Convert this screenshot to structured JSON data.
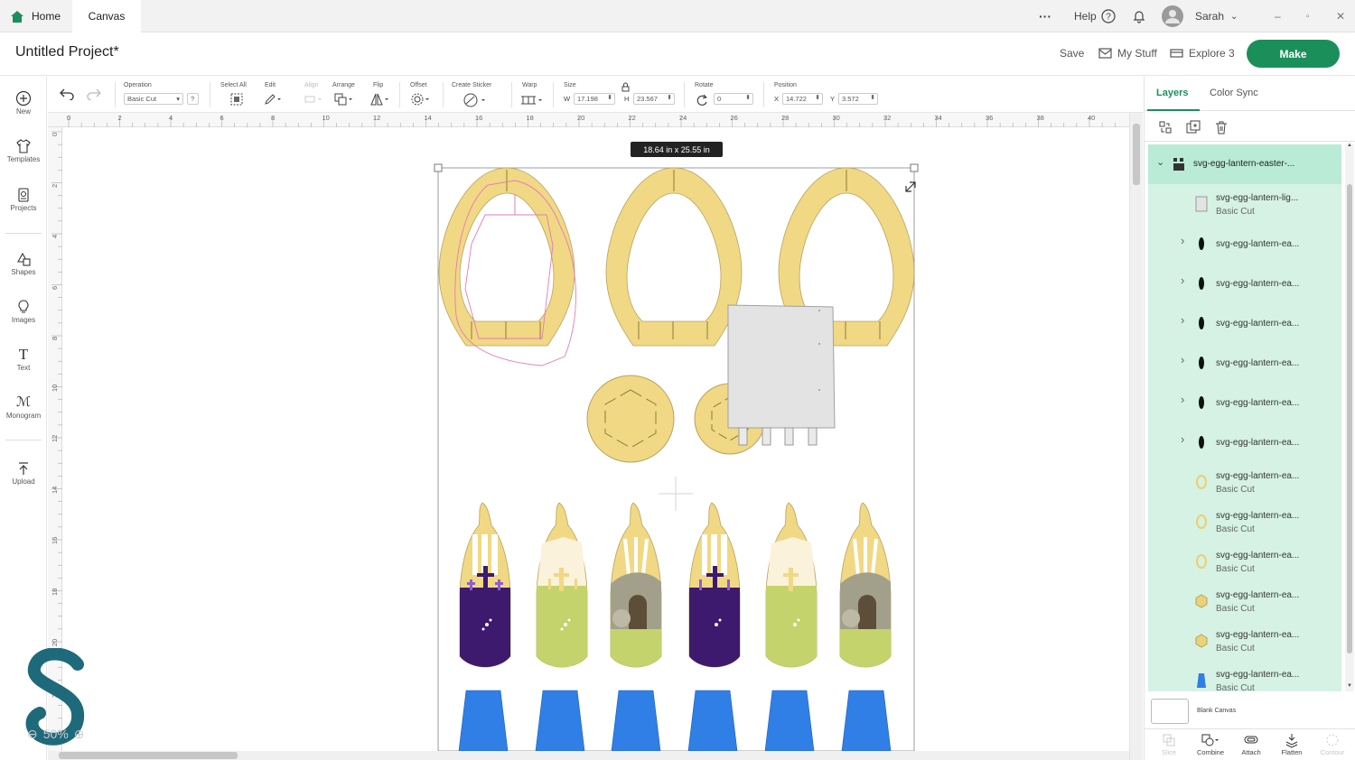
{
  "tabs": {
    "home": "Home",
    "canvas": "Canvas"
  },
  "topbar": {
    "more": "···",
    "help": "Help",
    "user": "Sarah",
    "minimize": "–",
    "restore": "▫",
    "close": "✕"
  },
  "header": {
    "title": "Untitled Project*",
    "save": "Save",
    "my_stuff": "My Stuff",
    "machine": "Explore 3",
    "make": "Make"
  },
  "leftbar": [
    "New",
    "Templates",
    "Projects",
    "Shapes",
    "Images",
    "Text",
    "Monogram",
    "Upload"
  ],
  "toolbar": {
    "operation_label": "Operation",
    "operation_value": "Basic Cut",
    "operation_help": "?",
    "select_all": "Select All",
    "edit": "Edit",
    "align": "Align",
    "arrange": "Arrange",
    "flip": "Flip",
    "offset": "Offset",
    "create_sticker": "Create Sticker",
    "warp": "Warp",
    "size": "Size",
    "w_label": "W",
    "w_value": "17.198",
    "h_label": "H",
    "h_value": "23.567",
    "rotate": "Rotate",
    "rotate_value": "0",
    "position": "Position",
    "x_label": "X",
    "x_value": "14.722",
    "y_label": "Y",
    "y_value": "3.572"
  },
  "ruler": {
    "top": [
      "0",
      "2",
      "4",
      "6",
      "8",
      "10",
      "12",
      "14",
      "16",
      "18",
      "20",
      "22",
      "24",
      "26",
      "28",
      "30",
      "32",
      "34",
      "36",
      "38",
      "40"
    ],
    "left": [
      "0",
      "2",
      "4",
      "6",
      "8",
      "10",
      "12",
      "14",
      "16",
      "18",
      "20",
      "22"
    ]
  },
  "canvas": {
    "dimension_tag": "18.64  in x 25.55  in",
    "zoom": "50%"
  },
  "panel": {
    "tab_layers": "Layers",
    "tab_color_sync": "Color Sync",
    "group_name": "svg-egg-lantern-easter-...",
    "layers": [
      {
        "name": "svg-egg-lantern-lig...",
        "sub": "Basic Cut",
        "expand": false,
        "thumb": "light",
        "color": "#e3e3e3"
      },
      {
        "name": "svg-egg-lantern-ea...",
        "sub": "",
        "expand": true,
        "thumb": "dark",
        "color": "#111111"
      },
      {
        "name": "svg-egg-lantern-ea...",
        "sub": "",
        "expand": true,
        "thumb": "dark",
        "color": "#111111"
      },
      {
        "name": "svg-egg-lantern-ea...",
        "sub": "",
        "expand": true,
        "thumb": "dark",
        "color": "#111111"
      },
      {
        "name": "svg-egg-lantern-ea...",
        "sub": "",
        "expand": true,
        "thumb": "dark",
        "color": "#111111"
      },
      {
        "name": "svg-egg-lantern-ea...",
        "sub": "",
        "expand": true,
        "thumb": "dark",
        "color": "#111111"
      },
      {
        "name": "svg-egg-lantern-ea...",
        "sub": "",
        "expand": true,
        "thumb": "dark",
        "color": "#111111"
      },
      {
        "name": "svg-egg-lantern-ea...",
        "sub": "Basic Cut",
        "expand": false,
        "thumb": "ring",
        "color": "#e9d27a"
      },
      {
        "name": "svg-egg-lantern-ea...",
        "sub": "Basic Cut",
        "expand": false,
        "thumb": "ring",
        "color": "#e9d27a"
      },
      {
        "name": "svg-egg-lantern-ea...",
        "sub": "Basic Cut",
        "expand": false,
        "thumb": "ring",
        "color": "#e9d27a"
      },
      {
        "name": "svg-egg-lantern-ea...",
        "sub": "Basic Cut",
        "expand": false,
        "thumb": "hex",
        "color": "#e9d27a"
      },
      {
        "name": "svg-egg-lantern-ea...",
        "sub": "Basic Cut",
        "expand": false,
        "thumb": "hex",
        "color": "#e9d27a"
      },
      {
        "name": "svg-egg-lantern-ea...",
        "sub": "Basic Cut",
        "expand": false,
        "thumb": "blue",
        "color": "#2f7fe6"
      }
    ],
    "blank_canvas": "Blank Canvas",
    "bottom": [
      "Slice",
      "Combine",
      "Attach",
      "Flatten",
      "Contour"
    ]
  },
  "colors": {
    "accent": "#1b8f5a",
    "egg_fill": "#f1d884",
    "blue": "#2f7fe6",
    "purple": "#3d1a6e",
    "green": "#c4d36b",
    "watermark": "#1e6a7b"
  }
}
